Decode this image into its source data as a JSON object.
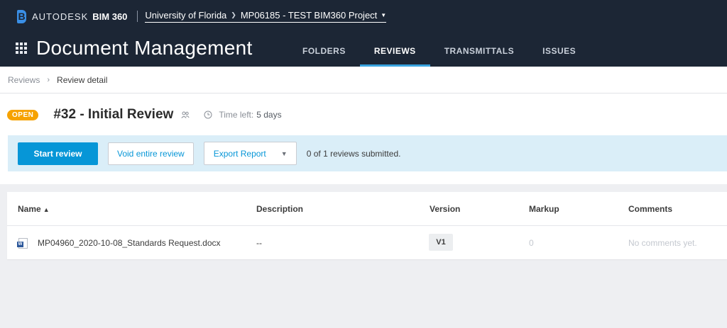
{
  "header": {
    "brand_autodesk": "AUTODESK",
    "brand_product": "BIM 360",
    "account": "University of Florida",
    "project": "MP06185 - TEST BIM360 Project",
    "app_title": "Document Management",
    "nav": [
      {
        "label": "FOLDERS",
        "active": false
      },
      {
        "label": "REVIEWS",
        "active": true
      },
      {
        "label": "TRANSMITTALS",
        "active": false
      },
      {
        "label": "ISSUES",
        "active": false
      }
    ]
  },
  "breadcrumb": {
    "parent": "Reviews",
    "current": "Review detail"
  },
  "review": {
    "status": "OPEN",
    "title": "#32 - Initial Review",
    "time_left_label": "Time left:",
    "time_left_value": "5 days",
    "actions": {
      "start": "Start review",
      "void": "Void entire review",
      "export": "Export Report",
      "submitted": "0 of 1 reviews submitted."
    }
  },
  "table": {
    "columns": [
      "Name",
      "Description",
      "Version",
      "Markup",
      "Comments"
    ],
    "rows": [
      {
        "name": "MP04960_2020-10-08_Standards Request.docx",
        "description": "--",
        "version": "V1",
        "markup": "0",
        "comments": "No comments yet."
      }
    ]
  },
  "colors": {
    "header_bg": "#1c2635",
    "accent": "#0696d7",
    "status_open": "#f6a200",
    "action_bar_bg": "#daeef8"
  },
  "icons": [
    "bim360-logo-icon",
    "app-waffle-icon",
    "project-chevron-icon",
    "caret-down-icon",
    "breadcrumb-chevron-icon",
    "people-icon",
    "clock-icon",
    "sort-up-icon",
    "word-file-icon"
  ]
}
